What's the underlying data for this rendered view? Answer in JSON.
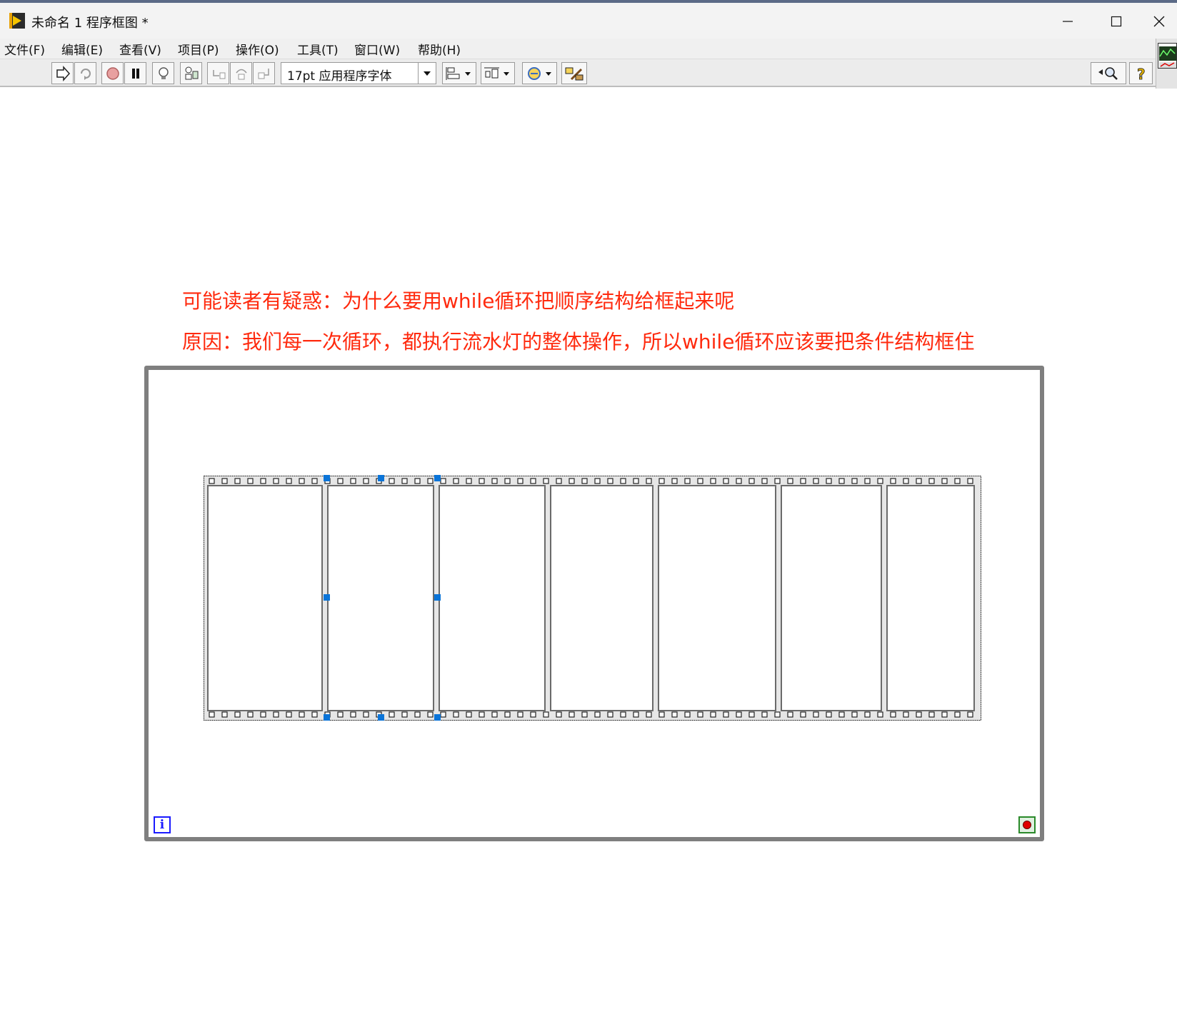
{
  "window": {
    "title": "未命名 1 程序框图 *",
    "controls": {
      "minimize": "—",
      "maximize": "☐",
      "close": "✕"
    }
  },
  "menu": [
    "文件(F)",
    "编辑(E)",
    "查看(V)",
    "项目(P)",
    "操作(O)",
    "工具(T)",
    "窗口(W)",
    "帮助(H)"
  ],
  "toolbar": {
    "buttons": [
      "run-arrow-icon",
      "run-continuously-icon",
      "abort-icon",
      "pause-icon",
      "highlight-execution-icon",
      "retain-wire-values-icon",
      "step-into-icon",
      "step-over-icon",
      "step-out-icon"
    ],
    "font_label": "17pt 应用程序字体",
    "align_buttons": [
      "align-objects-icon",
      "distribute-objects-icon",
      "reorder-icon",
      "cleanup-diagram-icon"
    ],
    "search_icon": "search-icon",
    "help_icon": "help-icon"
  },
  "notes": {
    "line1": "可能读者有疑惑：为什么要用while循环把顺序结构给框起来呢",
    "line2": "原因：我们每一次循环，都执行流水灯的整体操作，所以while循环应该要把条件结构框住"
  },
  "while_loop": {
    "iteration_label": "i",
    "frame_count": 7
  },
  "colors": {
    "note_text": "#ff2a0e",
    "loop_border": "#7f7f7f",
    "selection_handle": "#0a74d8"
  }
}
